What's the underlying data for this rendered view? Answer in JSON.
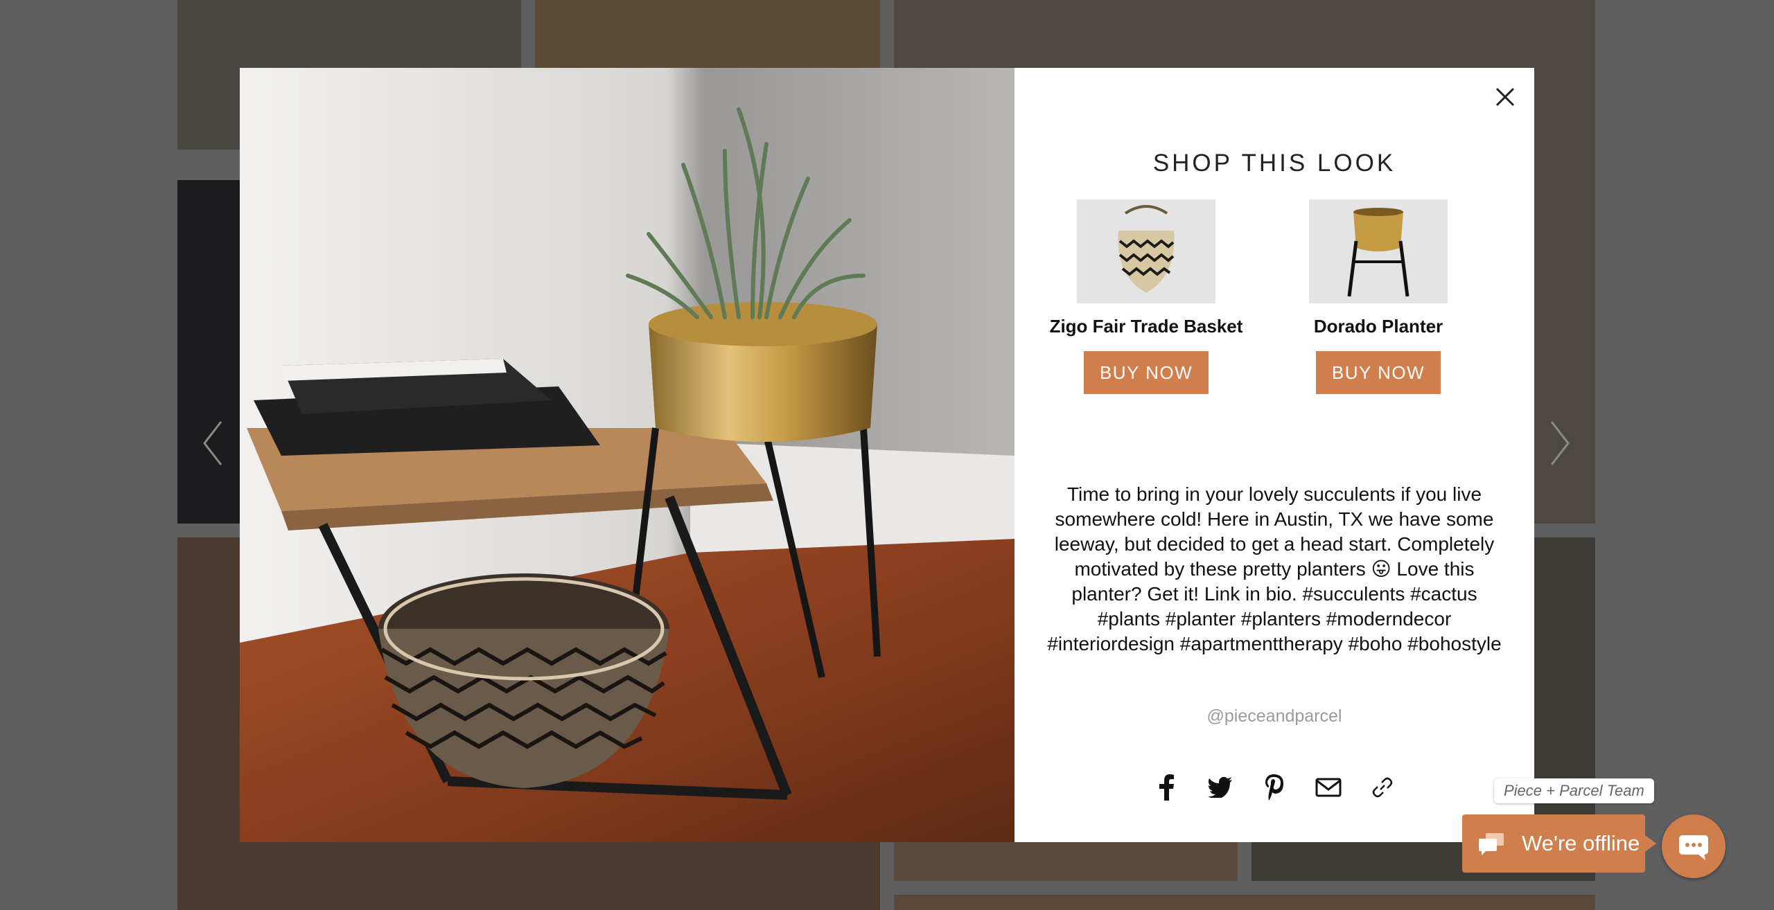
{
  "gallery": {
    "prev_label": "previous",
    "next_label": "next"
  },
  "modal": {
    "shop_title": "SHOP THIS LOOK",
    "products": [
      {
        "name": "Zigo Fair Trade Basket",
        "button": "BUY NOW",
        "icon": "basket-thumbnail"
      },
      {
        "name": "Dorado Planter",
        "button": "BUY NOW",
        "icon": "planter-thumbnail"
      }
    ],
    "caption": "Time to bring in your lovely succulents if you live somewhere cold! Here in Austin, TX we have some leeway, but decided to get a head start. Completely motivated by these pretty planters 😛 Love this planter? Get it! Link in bio. #succulents #cactus #plants #planter #planters #moderndecor #interiordesign #apartmenttherapy #boho #bohostyle",
    "handle": "@pieceandparcel",
    "share_icons": [
      "facebook-icon",
      "twitter-icon",
      "pinterest-icon",
      "email-icon",
      "link-icon"
    ]
  },
  "chat": {
    "team_label": "Piece + Parcel Team",
    "status_label": "We're offline"
  },
  "colors": {
    "accent": "#d07f4c",
    "overlay": "#5f5f5f"
  }
}
